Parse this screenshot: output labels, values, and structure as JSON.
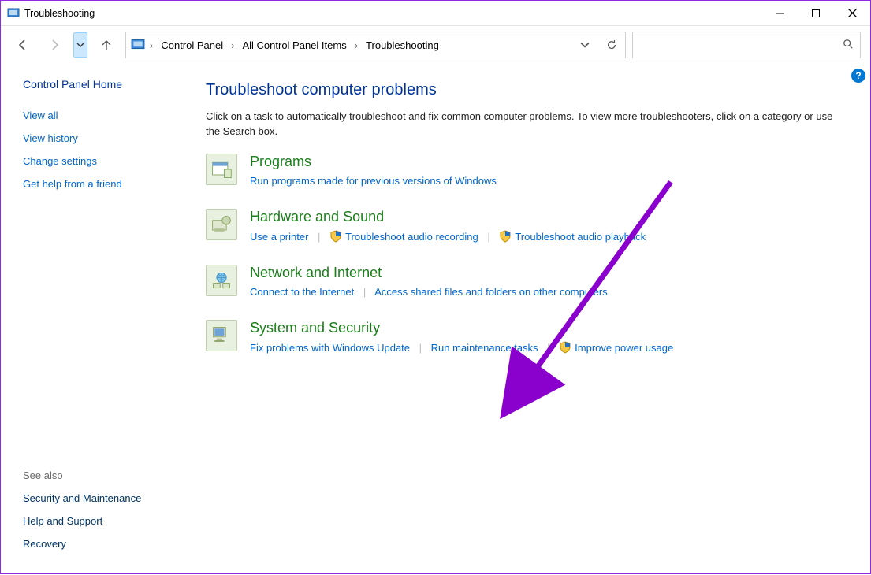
{
  "window": {
    "title": "Troubleshooting"
  },
  "breadcrumbs": {
    "items": [
      "Control Panel",
      "All Control Panel Items",
      "Troubleshooting"
    ]
  },
  "search": {
    "placeholder": ""
  },
  "sidebar": {
    "home": "Control Panel Home",
    "links": [
      "View all",
      "View history",
      "Change settings",
      "Get help from a friend"
    ],
    "see_also_label": "See also",
    "see_also": [
      "Security and Maintenance",
      "Help and Support",
      "Recovery"
    ]
  },
  "main": {
    "heading": "Troubleshoot computer problems",
    "intro": "Click on a task to automatically troubleshoot and fix common computer problems. To view more troubleshooters, click on a category or use the Search box.",
    "categories": [
      {
        "title": "Programs",
        "links": [
          {
            "label": "Run programs made for previous versions of Windows",
            "shield": false
          }
        ]
      },
      {
        "title": "Hardware and Sound",
        "links": [
          {
            "label": "Use a printer",
            "shield": false
          },
          {
            "label": "Troubleshoot audio recording",
            "shield": true
          },
          {
            "label": "Troubleshoot audio playback",
            "shield": true
          }
        ]
      },
      {
        "title": "Network and Internet",
        "links": [
          {
            "label": "Connect to the Internet",
            "shield": false
          },
          {
            "label": "Access shared files and folders on other computers",
            "shield": false
          }
        ]
      },
      {
        "title": "System and Security",
        "links": [
          {
            "label": "Fix problems with Windows Update",
            "shield": false
          },
          {
            "label": "Run maintenance tasks",
            "shield": false
          },
          {
            "label": "Improve power usage",
            "shield": true
          }
        ]
      }
    ]
  },
  "help_badge": "?"
}
